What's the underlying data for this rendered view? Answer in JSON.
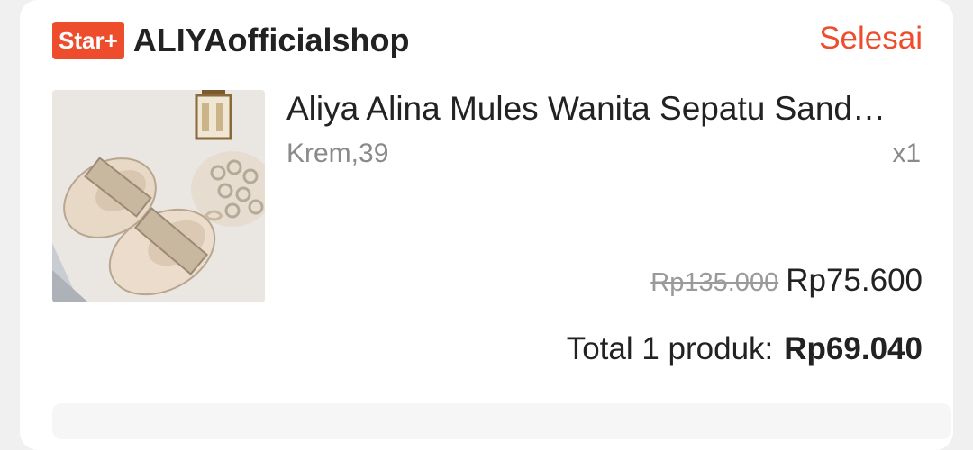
{
  "shop": {
    "badge": "Star+",
    "name": "ALIYAofficialshop",
    "status": "Selesai"
  },
  "product": {
    "name": "Aliya Alina Mules Wanita Sepatu Sand…",
    "variant": "Krem,39",
    "quantity": "x1",
    "original_price": "Rp135.000",
    "price": "Rp75.600",
    "image_icon": "shoe-product-photo"
  },
  "order": {
    "total_label": "Total 1 produk:",
    "total_amount": "Rp69.040"
  },
  "colors": {
    "accent": "#ee4d2d",
    "text": "#222222",
    "muted": "#8a8a8a"
  }
}
